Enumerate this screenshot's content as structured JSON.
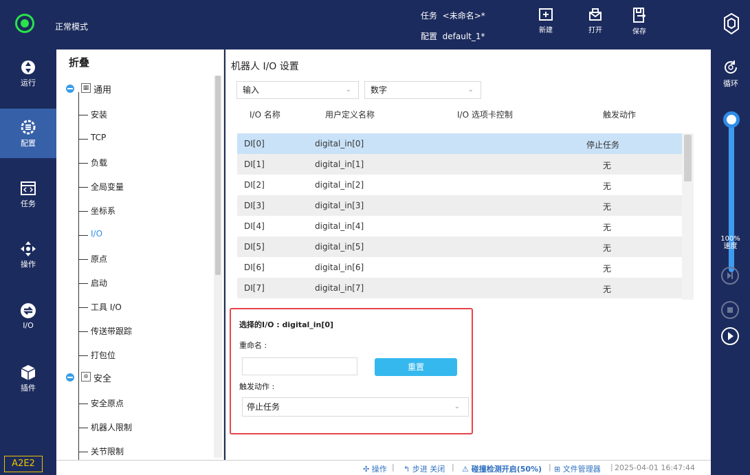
{
  "top": {
    "mode": "正常模式",
    "task_label": "任务",
    "task_value": "<未命名>*",
    "config_label": "配置",
    "config_value": "default_1*",
    "buttons": {
      "new": "新建",
      "open": "打开",
      "save": "保存"
    }
  },
  "nav": {
    "run": "运行",
    "config": "配置",
    "task": "任务",
    "operate": "操作",
    "io": "I/O",
    "plugin": "插件",
    "version": "A2E2"
  },
  "right": {
    "loop": "循环",
    "speed_label": "速度",
    "speed_value": "100%",
    "speed_fraction": 1.0
  },
  "tree": {
    "header": "折叠",
    "general": "通用",
    "general_items": [
      "安装",
      "TCP",
      "负载",
      "全局变量",
      "坐标系",
      "I/O",
      "原点",
      "启动",
      "工具 I/O",
      "传送带跟踪",
      "打包位"
    ],
    "selected": "I/O",
    "safety": "安全",
    "safety_items": [
      "安全原点",
      "机器人限制",
      "关节限制"
    ]
  },
  "main": {
    "title": "机器人 I/O 设置",
    "direction": "输入",
    "type": "数字",
    "columns": [
      "I/O 名称",
      "用户定义名称",
      "I/O 选项卡控制",
      "触发动作"
    ],
    "rows": [
      {
        "name": "DI[0]",
        "user": "digital_in[0]",
        "tab": "",
        "action": "停止任务"
      },
      {
        "name": "DI[1]",
        "user": "digital_in[1]",
        "tab": "",
        "action": "无"
      },
      {
        "name": "DI[2]",
        "user": "digital_in[2]",
        "tab": "",
        "action": "无"
      },
      {
        "name": "DI[3]",
        "user": "digital_in[3]",
        "tab": "",
        "action": "无"
      },
      {
        "name": "DI[4]",
        "user": "digital_in[4]",
        "tab": "",
        "action": "无"
      },
      {
        "name": "DI[5]",
        "user": "digital_in[5]",
        "tab": "",
        "action": "无"
      },
      {
        "name": "DI[6]",
        "user": "digital_in[6]",
        "tab": "",
        "action": "无"
      },
      {
        "name": "DI[7]",
        "user": "digital_in[7]",
        "tab": "",
        "action": "无"
      }
    ],
    "selected_label": "选择的I/O : digital_in[0]",
    "rename_label": "重命名 :",
    "rename_value": "",
    "reset": "重置",
    "trigger_label": "触发动作 :",
    "trigger_value": "停止任务"
  },
  "status": {
    "operate": "操作",
    "step": "步进 关闭",
    "collision": "碰撞检测开启(50%)",
    "file_manager": "文件管理器",
    "datetime": "2025-04-01 16:47:44"
  },
  "colors": {
    "accent": "#2f8de8",
    "nav_bg": "#1c2b5d",
    "nav_active": "#3660a8",
    "highlight": "#e8434b",
    "status_ok": "#28e34a"
  }
}
